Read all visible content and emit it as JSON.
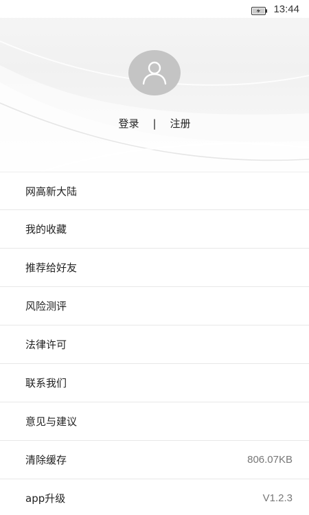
{
  "status_bar": {
    "time": "13:44",
    "battery_icon": "battery-charging-icon"
  },
  "header": {
    "avatar_icon": "user-icon",
    "login_label": "登录",
    "separator": "|",
    "register_label": "注册"
  },
  "menu": {
    "items": [
      {
        "label": "网高新大陆",
        "value": ""
      },
      {
        "label": "我的收藏",
        "value": ""
      },
      {
        "label": "推荐给好友",
        "value": ""
      },
      {
        "label": "风险测评",
        "value": ""
      },
      {
        "label": "法律许可",
        "value": ""
      },
      {
        "label": "联系我们",
        "value": ""
      },
      {
        "label": "意见与建议",
        "value": ""
      },
      {
        "label": "清除缓存",
        "value": "806.07KB"
      },
      {
        "label": "app升级",
        "value": "V1.2.3"
      }
    ]
  }
}
